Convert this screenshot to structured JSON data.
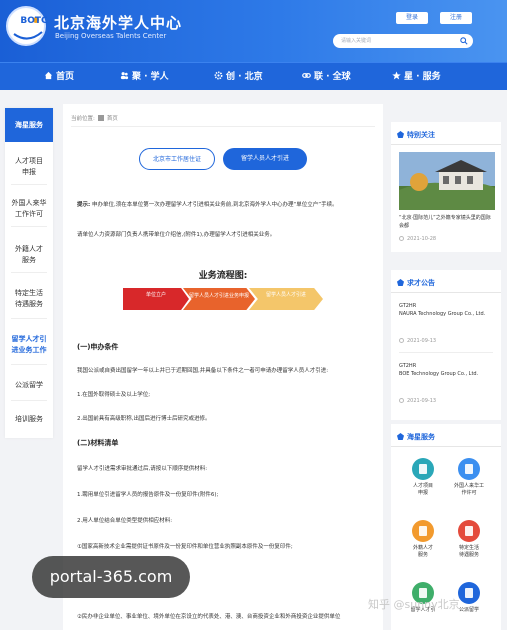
{
  "header": {
    "logo_text": "BOTC",
    "title": "北京海外学人中心",
    "subtitle": "Beijing Overseas Talents Center",
    "login_label": "登录",
    "register_label": "注册",
    "search_placeholder": "请输入关键词"
  },
  "nav": {
    "items": [
      {
        "label": "首页",
        "icon": "home-icon"
      },
      {
        "label": "聚 · 学人",
        "icon": "people-icon"
      },
      {
        "label": "创 · 北京",
        "icon": "gear-icon"
      },
      {
        "label": "联 · 全球",
        "icon": "link-icon"
      },
      {
        "label": "星 · 服务",
        "icon": "star-icon"
      }
    ]
  },
  "sidebar": {
    "header": "海星服务",
    "items": [
      {
        "label": "人才项目\n申报",
        "active": false
      },
      {
        "label": "外国人来华\n工作许可",
        "active": false
      },
      {
        "label": "外籍人才\n服务",
        "active": false
      },
      {
        "label": "特定生活\n待遇服务",
        "active": false
      },
      {
        "label": "留学人才引\n进业务工作",
        "active": true
      },
      {
        "label": "公派留学",
        "active": false
      },
      {
        "label": "培训服务",
        "active": false
      }
    ]
  },
  "main": {
    "breadcrumb_label": "当前位置:",
    "breadcrumb_home": "首页",
    "tabs": [
      "北京市工作居住证",
      "留学人员人才引进"
    ],
    "notice_prefix": "提示:",
    "notice": "申办单位,须在本单位第一次办理留学人才引进相关业务前,到北京海外学人中心办理“单位立户”手续。",
    "intro": "请单位人力资源部门负责人携带单位介绍信,(附件1),办理留学人才引进相关业务。",
    "flow_title": "业务流程图:",
    "flow_steps": [
      "单位立户",
      "留学人员人才引进业务申报",
      "留学人员人才引进"
    ],
    "section1": "(一)申办条件",
    "cond_intro": "我国公派或自费出国留学一年以上并已于近期回国,并具备以下条件之一者可申请办理留学人员人才引进:",
    "cond1": "1.在国外取得硕士及以上学位;",
    "cond2": "2.出国前具有高级职称,出国后进行博士后研究或进修。",
    "section2": "(二)材料清单",
    "mat_intro": "留学人才引进需求审批通过后,请按以下顺序提供材料:",
    "mat1": "1.聘用单位引进留学人员的报告原件及一份复印件(附件6);",
    "mat2": "2.用人单位结合单位类型提供相应材料:",
    "mat3": "①国家高新技术企业需提供证书原件及一份复印件和单位营业执照副本原件及一份复印件;",
    "mat4": "②民办非企业单位、事业单位、境外单位在京设立的代表处、港、澳、台商投资企业和外商投资企业提供单位"
  },
  "right": {
    "featured_title": "特别关注",
    "featured_text": "“北京·国际范儿”之外籍专家镜头里的国际会都",
    "featured_date": "2021-10-28",
    "jobs_title": "求才公告",
    "jobs": [
      {
        "title": "GT2HR\nNAURA Technology Group Co., Ltd.",
        "date": "2021-09-13"
      },
      {
        "title": "GT2HR\nBOE Technology Group Co., Ltd.",
        "date": "2021-09-13"
      }
    ],
    "services_title": "海星服务",
    "services": [
      {
        "label": "人才项目\n申报",
        "color": "#2aa7b8"
      },
      {
        "label": "外国人来华工\n作许可",
        "color": "#3b8ff0"
      },
      {
        "label": "外籍人才\n服务",
        "color": "#f29a2e"
      },
      {
        "label": "特定生活\n待遇服务",
        "color": "#e44b3c"
      },
      {
        "label": "留学人才引",
        "color": "#3fae6a"
      },
      {
        "label": "公派留学",
        "color": "#1f66db"
      }
    ]
  },
  "watermarks": {
    "pill": "portal-365.com",
    "zhihu": "知乎 @sunny北京"
  }
}
